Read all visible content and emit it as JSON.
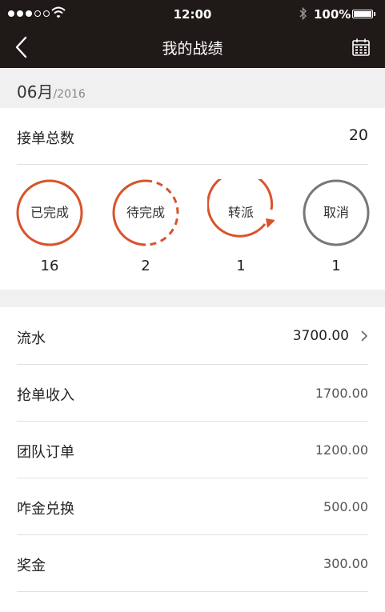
{
  "status_bar": {
    "time": "12:00",
    "battery": "100%",
    "signal_bars_filled": 3,
    "signal_bars_total": 5
  },
  "header": {
    "title": "我的战绩",
    "back_icon": "chevron-left-icon",
    "calendar_icon": "calendar-icon"
  },
  "period": {
    "month": "06月",
    "year": "/2016"
  },
  "summary": {
    "total_label": "接单总数",
    "total_value": "20"
  },
  "statuses": [
    {
      "label": "已完成",
      "count": "16",
      "style": "solid"
    },
    {
      "label": "待完成",
      "count": "2",
      "style": "dashed"
    },
    {
      "label": "转派",
      "count": "1",
      "style": "arrow"
    },
    {
      "label": "取消",
      "count": "1",
      "style": "gray"
    }
  ],
  "earnings": [
    {
      "label": "流水",
      "value": "3700.00"
    },
    {
      "label": "抢单收入",
      "value": "1700.00"
    },
    {
      "label": "团队订单",
      "value": "1200.00"
    },
    {
      "label": "咋金兑换",
      "value": "500.00"
    },
    {
      "label": "奖金",
      "value": "300.00"
    }
  ],
  "colors": {
    "accent": "#d9532a",
    "header_bg": "#1f1a17",
    "gray_circle": "#777777",
    "section_bg": "#f0f0f0"
  }
}
